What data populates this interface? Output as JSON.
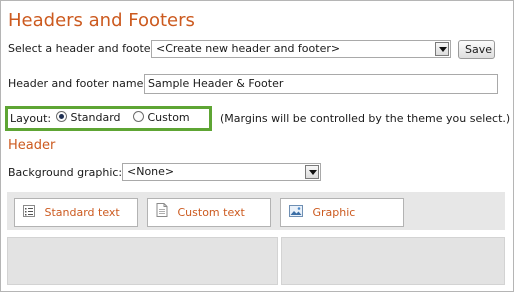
{
  "page": {
    "title": "Headers and Footers"
  },
  "select_header_footer": {
    "label": "Select a header and footer:",
    "value": "<Create new header and footer>",
    "save_label": "Save"
  },
  "name_field": {
    "label": "Header and footer name:",
    "value": "Sample Header & Footer"
  },
  "layout": {
    "label": "Layout:",
    "options": [
      {
        "label": "Standard",
        "selected": true
      },
      {
        "label": "Custom",
        "selected": false
      }
    ],
    "note": "(Margins will be controlled by the theme you select.)"
  },
  "header_section": {
    "title": "Header",
    "background_label": "Background graphic:",
    "background_value": "<None>"
  },
  "tools": [
    {
      "label": "Standard text",
      "icon": "list-icon"
    },
    {
      "label": "Custom text",
      "icon": "document-icon"
    },
    {
      "label": "Graphic",
      "icon": "image-icon"
    }
  ],
  "colors": {
    "accent": "#cc5a1f",
    "highlight_border": "#5ea534",
    "panel_gray": "#e3e3e3"
  }
}
